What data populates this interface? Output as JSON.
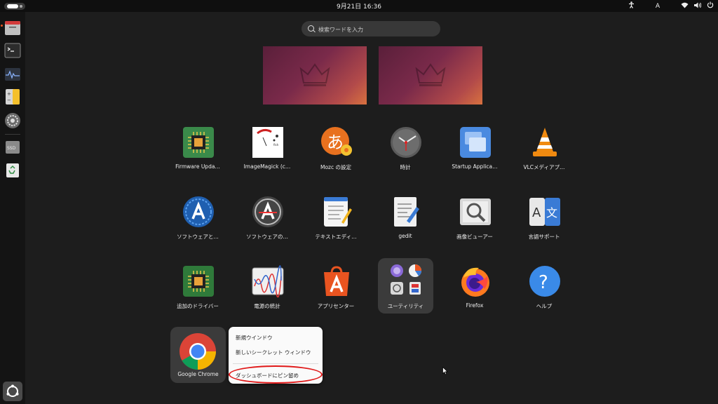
{
  "topbar": {
    "clock": "9月21日  16:36",
    "input_indicator": "A",
    "icons": [
      "activities-icon",
      "accessibility-icon",
      "network-icon",
      "volume-icon",
      "power-icon"
    ]
  },
  "dock": {
    "items": [
      "text-editor-icon",
      "terminal-icon",
      "system-monitor-icon",
      "calculator-icon",
      "settings-icon",
      "disk-icon",
      "trash-icon",
      "show-apps-icon"
    ]
  },
  "search": {
    "placeholder": "検索ワードを入力"
  },
  "workspaces": [
    "workspace-1",
    "workspace-2"
  ],
  "apps": [
    {
      "label": "Firmware Upda…",
      "icon": "firmware-chip-icon"
    },
    {
      "label": "ImageMagick (c…",
      "icon": "imagemagick-icon"
    },
    {
      "label": "Mozc の設定",
      "icon": "mozc-icon"
    },
    {
      "label": "時計",
      "icon": "clock-icon"
    },
    {
      "label": "Startup Applica…",
      "icon": "startup-apps-icon"
    },
    {
      "label": "VLCメディアプ…",
      "icon": "vlc-cone-icon"
    },
    {
      "label": "ソフトウェアと…",
      "icon": "software-updates-icon"
    },
    {
      "label": "ソフトウェアの…",
      "icon": "software-updater-icon"
    },
    {
      "label": "テキストエディ…",
      "icon": "text-editor-icon"
    },
    {
      "label": "gedit",
      "icon": "gedit-icon"
    },
    {
      "label": "画像ビューアー",
      "icon": "image-viewer-icon"
    },
    {
      "label": "言語サポート",
      "icon": "language-support-icon"
    },
    {
      "label": "追加のドライバー",
      "icon": "additional-drivers-icon"
    },
    {
      "label": "電源の統計",
      "icon": "power-statistics-icon"
    },
    {
      "label": "アプリセンター",
      "icon": "app-center-icon"
    },
    {
      "label": "ユーティリティ",
      "icon": "utilities-folder-icon"
    },
    {
      "label": "Firefox",
      "icon": "firefox-icon"
    },
    {
      "label": "ヘルプ",
      "icon": "help-icon"
    },
    {
      "label": "Google Chrome",
      "icon": "chrome-icon"
    }
  ],
  "context_menu": {
    "items": [
      "新規ウインドウ",
      "新しいシークレット ウィンドウ",
      "ダッシュボードにピン留め"
    ]
  },
  "colors": {
    "accent": "#e95420",
    "highlight_ring": "#e01818"
  }
}
